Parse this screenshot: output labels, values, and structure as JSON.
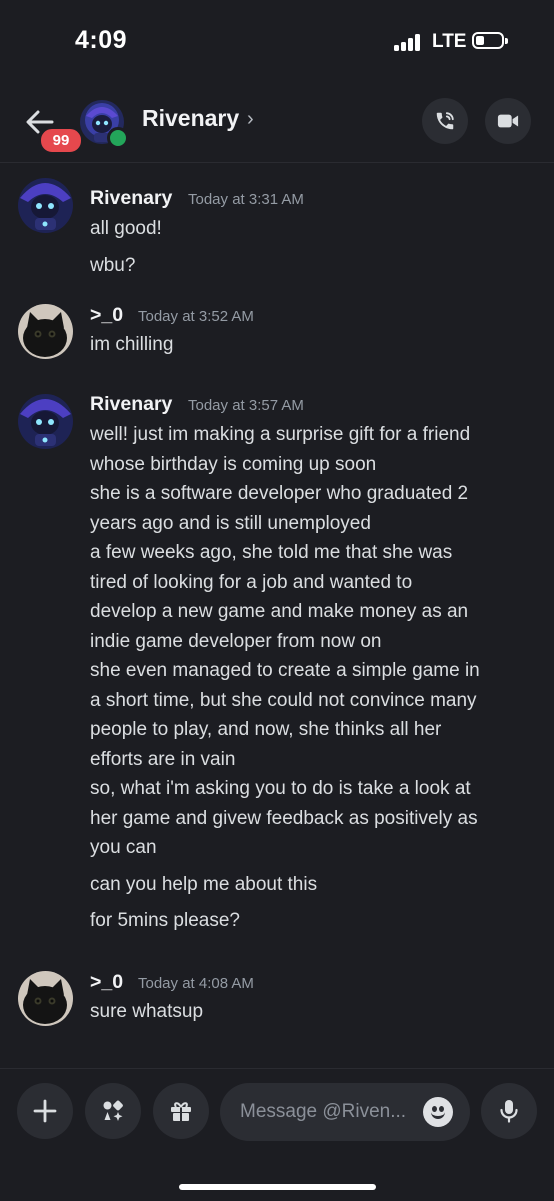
{
  "status_bar": {
    "time": "4:09",
    "carrier": "LTE"
  },
  "header": {
    "unread_badge": "99",
    "contact_name": "Rivenary",
    "chevron": "›",
    "icons": {
      "back": "arrow-left-icon",
      "call": "phone-call-icon",
      "video": "video-camera-icon"
    },
    "online_status_color": "#23a55a"
  },
  "messages": [
    {
      "author": "Rivenary",
      "timestamp": "Today at 3:31 AM",
      "avatar": "robot-avatar",
      "lines": [
        "all good!",
        "wbu?"
      ]
    },
    {
      "author": ">_0",
      "timestamp": "Today at 3:52 AM",
      "avatar": "cat-avatar",
      "lines": [
        "im chilling"
      ]
    },
    {
      "author": "Rivenary",
      "timestamp": "Today at 3:57 AM",
      "avatar": "robot-avatar",
      "lines": [
        "well! just im making a surprise gift for a friend",
        "whose birthday is coming up soon",
        "she is a software developer who graduated 2",
        "years ago and is still unemployed",
        "a few weeks ago, she told me that she was",
        "tired of looking for a job and wanted to",
        "develop a new game and make money as an",
        "indie game developer from now on",
        "she even managed to create a simple game in",
        "a short time, but she could not convince many",
        "people to play, and now, she thinks all her",
        "efforts are in vain",
        "so, what i'm asking you to do is take a look at",
        "her game and givew feedback as positively as",
        "you can",
        "can you help me about this",
        "for 5mins please?"
      ]
    },
    {
      "author": ">_0",
      "timestamp": "Today at 4:08 AM",
      "avatar": "cat-avatar",
      "lines": [
        "sure whatsup"
      ]
    }
  ],
  "composer": {
    "placeholder": "Message @Riven...",
    "icons": {
      "add": "plus-icon",
      "apps": "apps-sparkle-icon",
      "gift": "gift-icon",
      "emoji": "emoji-smile-icon",
      "voice": "microphone-icon"
    }
  },
  "colors": {
    "background": "#1c1d22",
    "button_bg": "#2b2d33",
    "badge_red": "#e5484d",
    "timestamp": "#949ba4"
  }
}
